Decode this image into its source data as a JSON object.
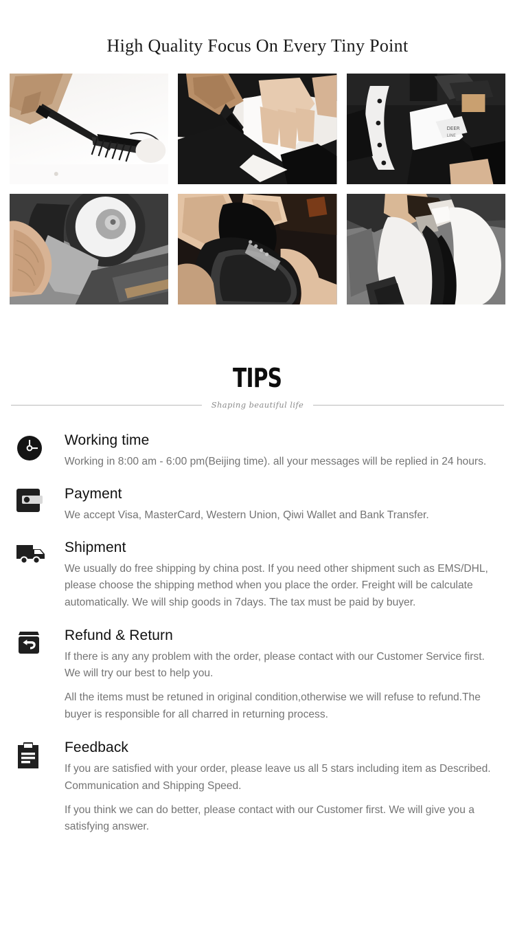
{
  "banner": {
    "title": "High Quality Focus On Every Tiny Point"
  },
  "gallery": {
    "rows": [
      [
        {
          "alt": "craftsman sketching pattern with pen on white paper"
        },
        {
          "alt": "hands cutting black leather with a knife"
        },
        {
          "alt": "metal cutting die pressing white and black leather"
        }
      ],
      [
        {
          "alt": "hands grinding leather edge on a polishing machine"
        },
        {
          "alt": "hands shaping a black leather shoe upper"
        },
        {
          "alt": "hands applying finish to white and black leather"
        }
      ]
    ]
  },
  "tips_header": {
    "word": "TIPS",
    "subtitle": "Shaping beautiful life"
  },
  "tips": [
    {
      "icon": "clock-icon",
      "title": "Working time",
      "paragraphs": [
        "Working in 8:00 am - 6:00 pm(Beijing time). all your messages will be replied in 24 hours."
      ]
    },
    {
      "icon": "wallet-icon",
      "title": "Payment",
      "paragraphs": [
        "We accept Visa, MasterCard, Western Union, Qiwi Wallet and Bank Transfer."
      ]
    },
    {
      "icon": "truck-icon",
      "title": "Shipment",
      "paragraphs": [
        "We usually do free shipping by china post. If you need other shipment such as EMS/DHL, please choose the shipping method when you place the order. Freight will be calculate automatically. We will ship goods in 7days. The tax must be paid by buyer."
      ]
    },
    {
      "icon": "return-box-icon",
      "title": "Refund & Return",
      "paragraphs": [
        "If there is any any problem with the order, please contact with our Customer Service first. We will try our best to help you.",
        "All the items must be retuned in original condition,otherwise we will refuse to refund.The buyer is responsible for all charred in returning process."
      ]
    },
    {
      "icon": "clipboard-icon",
      "title": "Feedback",
      "paragraphs": [
        "If you are satisfied with your order, please leave us all 5 stars including item as Described. Communication and Shipping Speed.",
        "If you think we can do better, please contact with our Customer first. We will give you a satisfying answer."
      ]
    }
  ],
  "colors": {
    "heading": "#111111",
    "body_text": "#737373",
    "icon_dark": "#1f1f1f",
    "rule": "#b9b9b9",
    "background": "#ffffff"
  }
}
